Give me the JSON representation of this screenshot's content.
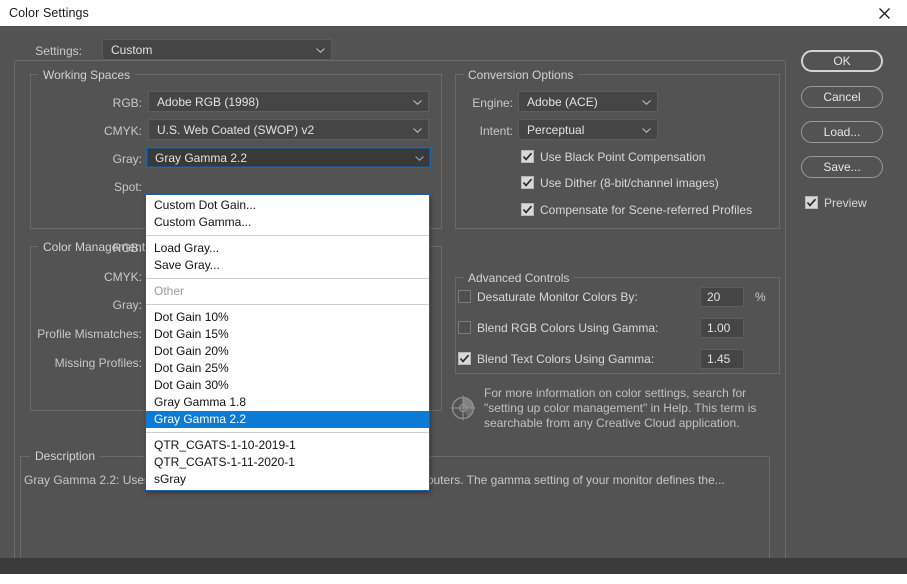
{
  "window": {
    "title": "Color Settings",
    "close_icon": "close-icon"
  },
  "settings_row": {
    "label": "Settings:",
    "value": "Custom"
  },
  "working_spaces": {
    "group_label": "Working Spaces",
    "rgb_label": "RGB:",
    "rgb_value": "Adobe RGB (1998)",
    "cmyk_label": "CMYK:",
    "cmyk_value": "U.S. Web Coated (SWOP) v2",
    "gray_label": "Gray:",
    "gray_value": "Gray Gamma 2.2",
    "spot_label": "Spot:"
  },
  "color_management": {
    "group_label": "Color Management",
    "rgb_label": "RGB:",
    "cmyk_label": "CMYK:",
    "gray_label": "Gray:",
    "profile_mismatches_label": "Profile Mismatches:",
    "missing_profiles_label": "Missing Profiles:"
  },
  "gray_dropdown": {
    "selected": "Gray Gamma 2.2",
    "groups": [
      {
        "items": [
          {
            "label": "Custom Dot Gain...",
            "state": "normal"
          },
          {
            "label": "Custom Gamma...",
            "state": "normal"
          }
        ]
      },
      {
        "items": [
          {
            "label": "Load Gray...",
            "state": "normal"
          },
          {
            "label": "Save Gray...",
            "state": "normal"
          }
        ]
      },
      {
        "items": [
          {
            "label": "Other",
            "state": "muted"
          }
        ]
      },
      {
        "items": [
          {
            "label": "Dot Gain 10%",
            "state": "normal"
          },
          {
            "label": "Dot Gain 15%",
            "state": "normal"
          },
          {
            "label": "Dot Gain 20%",
            "state": "normal"
          },
          {
            "label": "Dot Gain 25%",
            "state": "normal"
          },
          {
            "label": "Dot Gain 30%",
            "state": "normal"
          },
          {
            "label": "Gray Gamma 1.8",
            "state": "normal"
          },
          {
            "label": "Gray Gamma 2.2",
            "state": "selected"
          }
        ]
      },
      {
        "items": [
          {
            "label": "QTR_CGATS-1-10-2019-1",
            "state": "normal"
          },
          {
            "label": "QTR_CGATS-1-11-2020-1",
            "state": "normal"
          },
          {
            "label": "sGray",
            "state": "normal"
          }
        ]
      }
    ]
  },
  "conversion_options": {
    "group_label": "Conversion Options",
    "engine_label": "Engine:",
    "engine_value": "Adobe (ACE)",
    "intent_label": "Intent:",
    "intent_value": "Perceptual",
    "checkboxes": [
      {
        "label": "Use Black Point Compensation",
        "checked": true
      },
      {
        "label": "Use Dither (8-bit/channel images)",
        "checked": true
      },
      {
        "label": "Compensate for Scene-referred Profiles",
        "checked": true
      }
    ]
  },
  "advanced_controls": {
    "group_label": "Advanced Controls",
    "rows": [
      {
        "label": "Desaturate Monitor Colors By:",
        "checked": false,
        "value": "20",
        "suffix": "%"
      },
      {
        "label": "Blend RGB Colors Using Gamma:",
        "checked": false,
        "value": "1.00",
        "suffix": ""
      },
      {
        "label": "Blend Text Colors Using Gamma:",
        "checked": true,
        "value": "1.45",
        "suffix": ""
      }
    ]
  },
  "help": {
    "icon": "color-wheel-icon",
    "text": "For more information on color settings, search for \"setting up color management\" in Help. This term is searchable from any Creative Cloud application."
  },
  "description": {
    "group_label": "Description",
    "text": "Gray Gamma 2.2:  Uses a gamma value of 2.2, the default for Windows computers.  The gamma setting of your monitor defines the..."
  },
  "buttons": {
    "ok": "OK",
    "cancel": "Cancel",
    "load": "Load...",
    "save": "Save...",
    "preview_label": "Preview",
    "preview_checked": true
  },
  "colors": {
    "dialog_bg": "#535353",
    "titlebar_bg": "#ffffff",
    "accent_highlight": "#0d7bd4",
    "focus_border": "#1a5fa8"
  }
}
